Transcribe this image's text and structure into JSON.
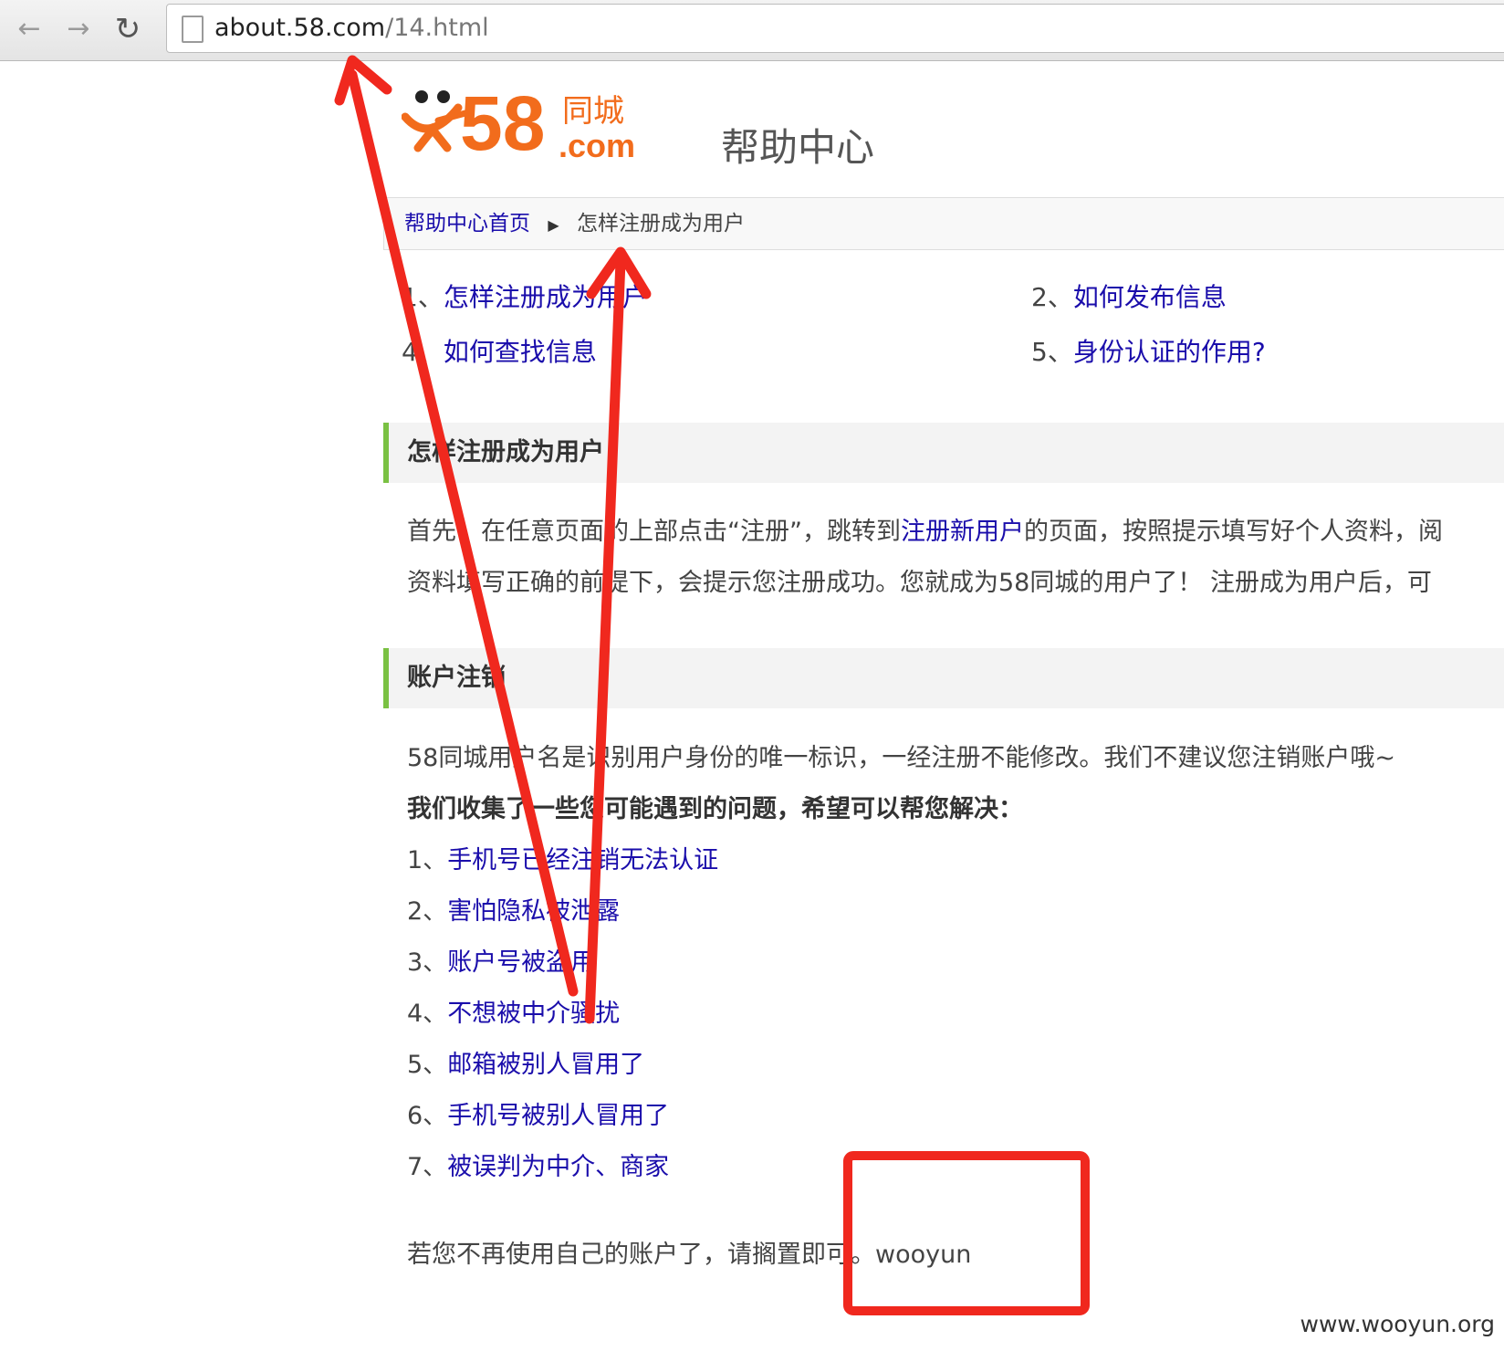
{
  "browser": {
    "back_icon": "back-arrow-icon",
    "forward_icon": "forward-arrow-icon",
    "reload_icon": "reload-icon",
    "url_host": "about.58.com",
    "url_path": "/14.html"
  },
  "header": {
    "logo_number": "58",
    "logo_cn": "同城",
    "logo_com": ".com",
    "title": "帮助中心"
  },
  "breadcrumb": {
    "home": "帮助中心首页",
    "current": "怎样注册成为用户"
  },
  "quick_links": [
    {
      "num": "1、",
      "label": "怎样注册成为用户"
    },
    {
      "num": "2、",
      "label": "如何发布信息"
    },
    {
      "num": "4、",
      "label": "如何查找信息"
    },
    {
      "num": "5、",
      "label": "身份认证的作用?"
    }
  ],
  "section_register": {
    "title": "怎样注册成为用户",
    "line1_a": "首先，在任意页面的上部点击“注册”，跳转到",
    "line1_link": "注册新用户",
    "line1_b": "的页面，按照提示填写好个人资料，阅",
    "line2": "资料填写正确的前提下，会提示您注册成功。您就成为58同城的用户了！ 注册成为用户后，可"
  },
  "section_cancel": {
    "title": "账户注销",
    "line1": "58同城用户名是识别用户身份的唯一标识，一经注册不能修改。我们不建议您注销账户哦~",
    "line2": "我们收集了一些您可能遇到的问题，希望可以帮您解决：",
    "items": [
      {
        "num": "1、",
        "label": "手机号已经注销无法认证"
      },
      {
        "num": "2、",
        "label": "害怕隐私被泄露"
      },
      {
        "num": "3、",
        "label": "账户号被盗用"
      },
      {
        "num": "4、",
        "label": "不想被中介骚扰"
      },
      {
        "num": "5、",
        "label": "邮箱被别人冒用了"
      },
      {
        "num": "6、",
        "label": "手机号被别人冒用了"
      },
      {
        "num": "7、",
        "label": "被误判为中介、商家"
      }
    ],
    "closing": "若您不再使用自己的账户了，请搁置即可。wooyun"
  },
  "watermark": "www.wooyun.org",
  "colors": {
    "link": "#1a0dab",
    "annotation": "#f0281e",
    "section_accent": "#7ac143",
    "logo_orange": "#f26c1c"
  }
}
